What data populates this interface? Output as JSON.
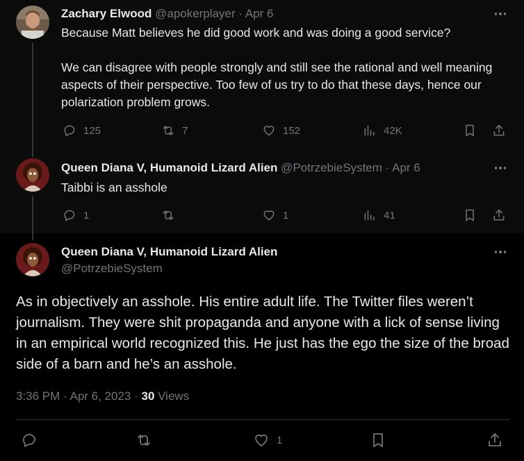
{
  "tweets": [
    {
      "name": "Zachary Elwood",
      "handle": "@apokerplayer",
      "date": "· Apr 6",
      "text": "Because Matt believes he did good work and was doing a good service?\n\nWe can disagree with people strongly and still see the rational and well meaning aspects of their perspective. Too few of us try to do that these days, hence our polarization problem grows.",
      "replies": "125",
      "retweets": "7",
      "likes": "152",
      "views": "42K"
    },
    {
      "name": "Queen Diana V, Humanoid Lizard Alien",
      "handle": "@PotrzebieSystem",
      "date": "· Apr 6",
      "text": "Taibbi is an asshole",
      "replies": "1",
      "retweets": "",
      "likes": "1",
      "views": "41"
    }
  ],
  "main_tweet": {
    "name": "Queen Diana V, Humanoid Lizard Alien",
    "handle": "@PotrzebieSystem",
    "text": "As in objectively an asshole. His entire adult life. The Twitter files weren’t journalism. They were shit propaganda and anyone with a lick of sense living in an empirical world recognized this. He just has the ego the size of the broad side of a barn and he’s an asshole.",
    "timestamp": "3:36 PM · Apr 6, 2023 · ",
    "views_count": "30",
    "views_label": "Views",
    "likes": "1"
  },
  "colors": {
    "background": "#000000",
    "text": "#e7e9ea",
    "muted": "#71767b",
    "thread_line": "#333639"
  },
  "icons": [
    "reply-icon",
    "retweet-icon",
    "like-icon",
    "views-icon",
    "bookmark-icon",
    "share-icon",
    "more-icon"
  ]
}
